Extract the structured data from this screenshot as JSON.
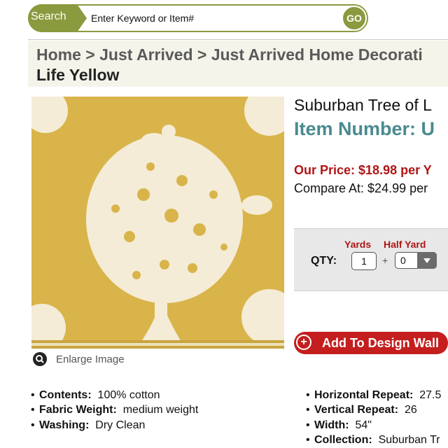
{
  "search": {
    "tab_label": "Search",
    "placeholder": "Enter Keyword or Item#",
    "go_label": "GO"
  },
  "breadcrumb": {
    "items": [
      "Home",
      "Just Arrived",
      "Just Arrived Home Decorati"
    ],
    "separator": ">",
    "title": "Life Yellow"
  },
  "product": {
    "title": "Suburban Tree of L",
    "item_number": "Item Number: U",
    "our_price": "Our Price: $18.98 per Y",
    "compare_at": "Compare At: $24.99 per",
    "enlarge_label": "Enlarge Image",
    "image_colors": {
      "background": "#d9b44a",
      "motif": "#f4ecd6"
    }
  },
  "quantity": {
    "qty_label": "QTY:",
    "yards_label": "Yards",
    "half_yard_label": "Half Yard",
    "yards_value": "1",
    "plus": "+",
    "half_yard_value": "0"
  },
  "add_button": {
    "icon": "+",
    "label": "Add To Design Wall"
  },
  "specs_left": [
    {
      "label": "Contents:",
      "value": "100% cotton"
    },
    {
      "label": "Fabric Weight:",
      "value": "medium weight"
    },
    {
      "label": "Washing:",
      "value": "Dry Clean"
    }
  ],
  "specs_right": [
    {
      "label": "Horizontal Repeat:",
      "value": "27.5"
    },
    {
      "label": "Vertical Repeat:",
      "value": "26"
    },
    {
      "label": "Width:",
      "value": "54\""
    },
    {
      "label": "Collection:",
      "value": "Suburban Tr"
    }
  ],
  "colors": {
    "accent_green": "#8a9a3e",
    "price_red": "#b01515",
    "item_teal": "#4a8a90",
    "button_red": "#c41e1e"
  }
}
